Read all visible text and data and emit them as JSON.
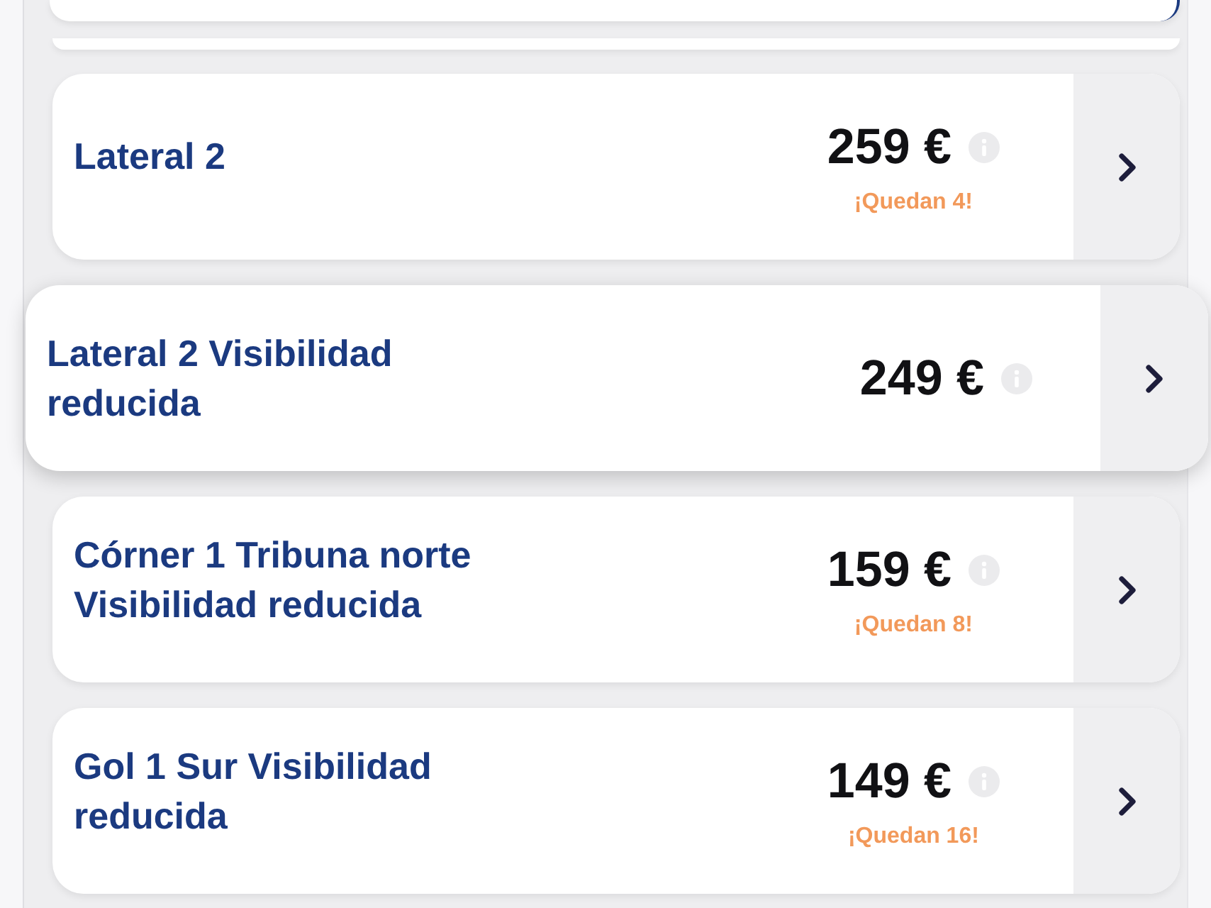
{
  "tickets": [
    {
      "title": "Lateral 2",
      "price": "259 €",
      "remaining": "¡Quedan 4!",
      "selected": false
    },
    {
      "title": "Lateral 2 Visibilidad reducida",
      "price": "249 €",
      "selected": true
    },
    {
      "title": "Córner 1 Tribuna norte Visibilidad reducida",
      "price": "159 €",
      "remaining": "¡Quedan 8!",
      "selected": false
    },
    {
      "title": "Gol 1 Sur Visibilidad reducida",
      "price": "149 €",
      "remaining": "¡Quedan 16!",
      "selected": false
    }
  ]
}
